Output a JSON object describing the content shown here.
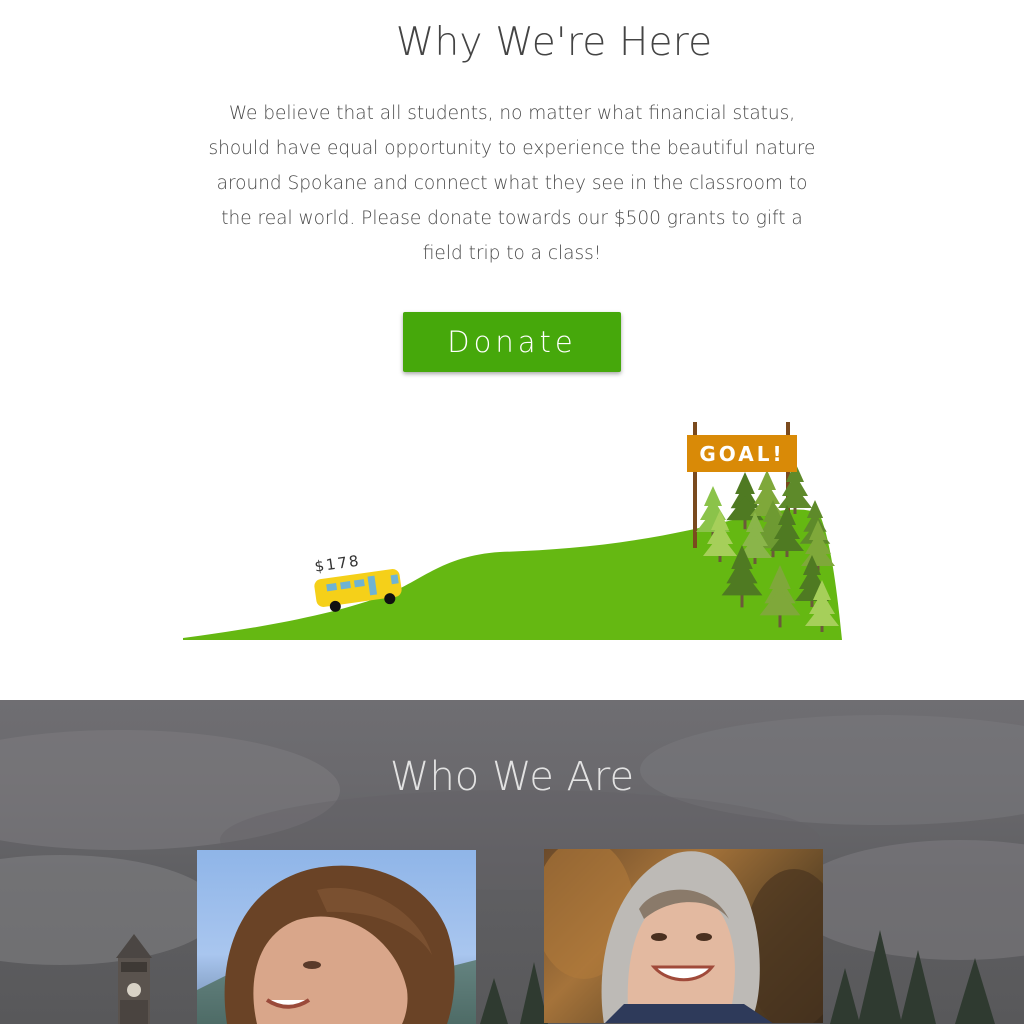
{
  "why": {
    "title": "Why We're Here",
    "body": "We believe that all students, no matter what financial status, should have equal opportunity to experience the beautiful nature around Spokane and connect what they see in the classroom to the real world. Please donate towards our $500 grants to gift a field trip to a class!",
    "donate_label": "Donate"
  },
  "progress": {
    "amount_label": "$178",
    "goal_label": "GOAL!",
    "raised": 178,
    "goal": 500
  },
  "who": {
    "title": "Who We Are"
  },
  "colors": {
    "accent_green": "#46a80b",
    "hill_green": "#65b812",
    "bus_yellow": "#f5d019",
    "sign_orange": "#d98a07"
  }
}
